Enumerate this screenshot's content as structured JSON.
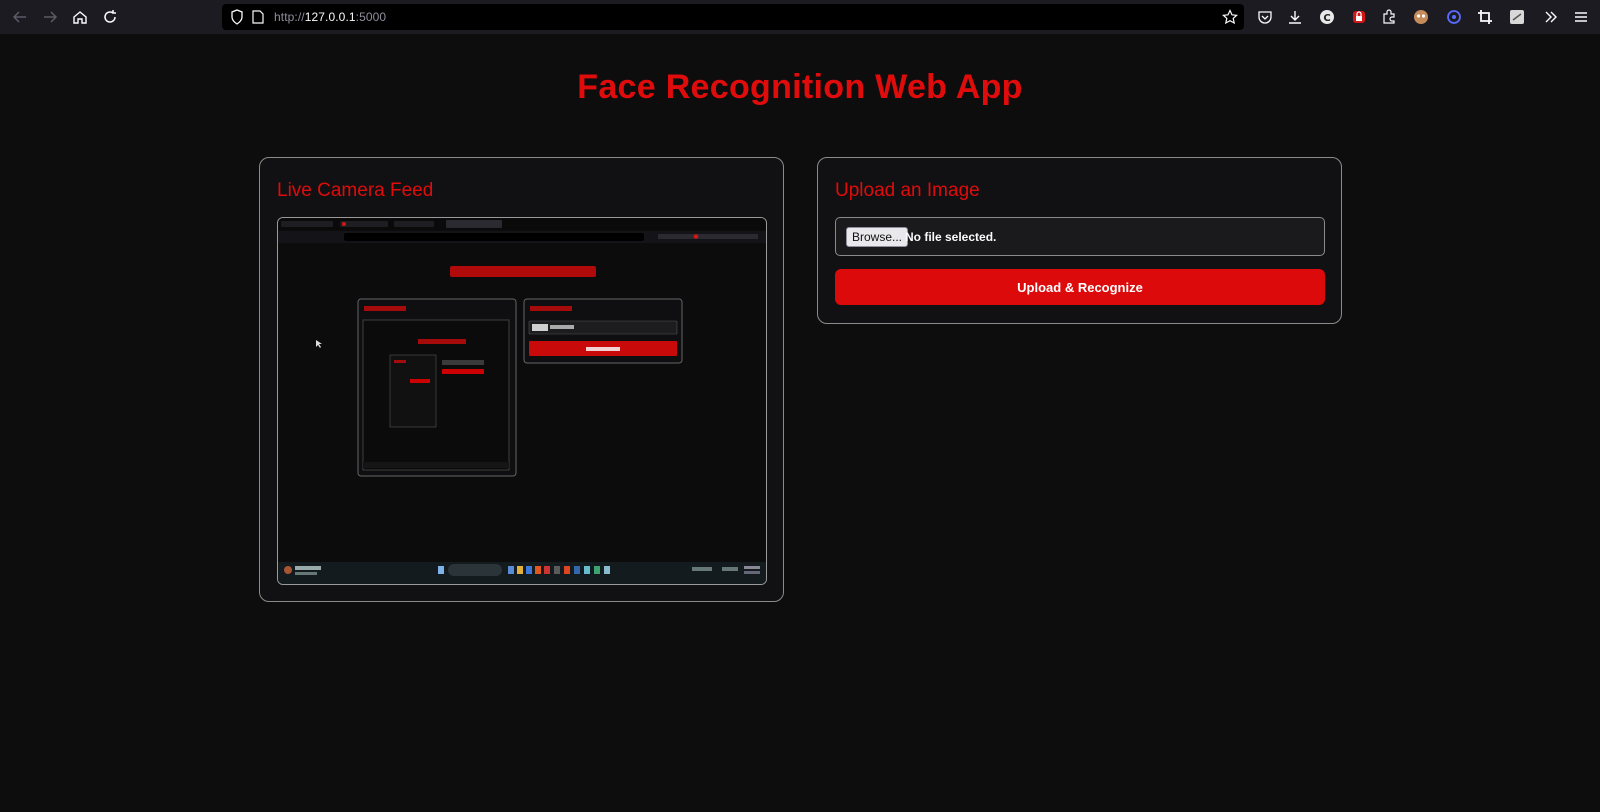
{
  "browser": {
    "url_prefix": "http://",
    "url_host": "127.0.0.1",
    "url_port": ":5000"
  },
  "page": {
    "title": "Face Recognition Web App"
  },
  "camera": {
    "title": "Live Camera Feed"
  },
  "upload": {
    "title": "Upload an Image",
    "browse_label": "Browse...",
    "file_status": "No file selected.",
    "button_label": "Upload & Recognize"
  },
  "colors": {
    "accent": "#e00b0b",
    "background": "#0d0d0e",
    "button": "#dc0a0a"
  }
}
